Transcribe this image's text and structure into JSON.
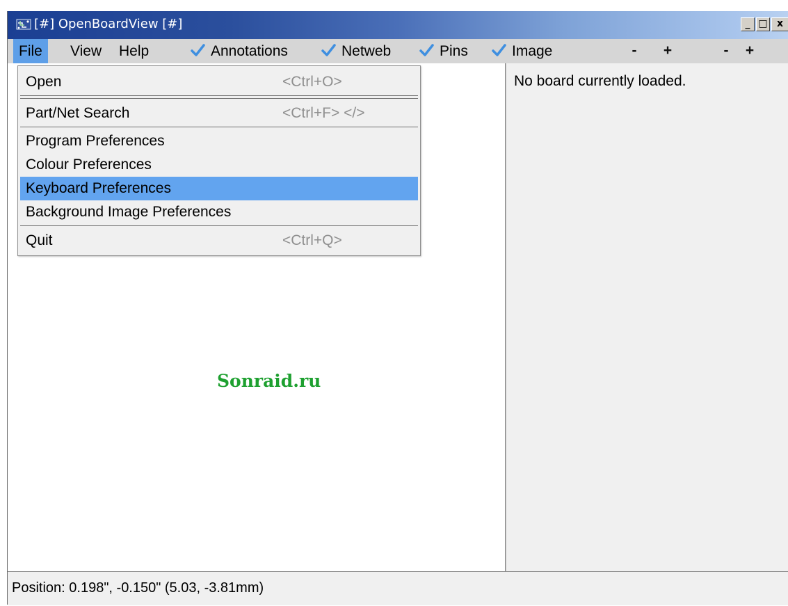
{
  "window": {
    "title": "[#] OpenBoardView [#]",
    "minimize_glyph": "_",
    "maximize_glyph": "□",
    "close_glyph": "x"
  },
  "menubar": {
    "file": "File",
    "view": "View",
    "help": "Help",
    "toggles": [
      {
        "label": "Annotations",
        "checked": true
      },
      {
        "label": "Netweb",
        "checked": true
      },
      {
        "label": "Pins",
        "checked": true
      },
      {
        "label": "Image",
        "checked": true
      }
    ],
    "zoom_buttons": [
      "-",
      "+",
      "-",
      "+"
    ]
  },
  "file_menu": {
    "items": [
      {
        "label": "Open",
        "shortcut": "<Ctrl+O>"
      },
      {
        "label": "Part/Net Search",
        "shortcut": "<Ctrl+F> </>"
      },
      {
        "label": "Program Preferences",
        "shortcut": ""
      },
      {
        "label": "Colour Preferences",
        "shortcut": ""
      },
      {
        "label": "Keyboard Preferences",
        "shortcut": "",
        "highlighted": true
      },
      {
        "label": "Background Image Preferences",
        "shortcut": ""
      },
      {
        "label": "Quit",
        "shortcut": "<Ctrl+Q>"
      }
    ]
  },
  "right_panel": {
    "message": "No board currently loaded."
  },
  "watermark": "Sonraid.ru",
  "statusbar": {
    "text": "Position: 0.198\", -0.150\" (5.03, -3.81mm)"
  },
  "colors": {
    "check": "#3f8fe0",
    "highlight": "#62a4ef",
    "menubar_active": "#5e9fe8",
    "watermark": "#1ea030",
    "titlebar_start": "#1b3f93",
    "titlebar_end": "#b9d1f1"
  }
}
